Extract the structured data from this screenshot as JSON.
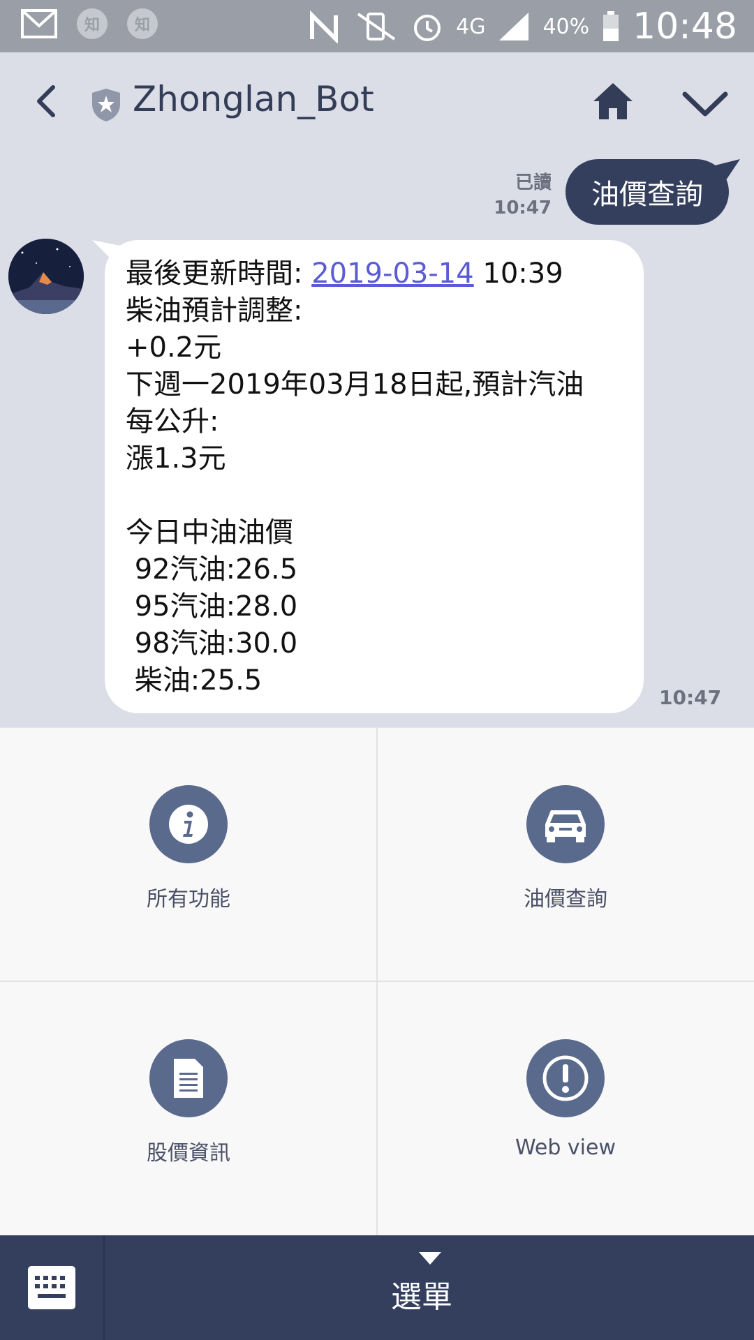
{
  "status_bar": {
    "icons_left": [
      "gmail-icon",
      "zhihu-icon",
      "zhihu-icon"
    ],
    "zhihu_label": "知",
    "network": "4G",
    "battery": "40%",
    "time": "10:48"
  },
  "header": {
    "title": "Zhonglan_Bot"
  },
  "chat": {
    "outgoing": {
      "text": "油價查詢",
      "read_label": "已讀",
      "time": "10:47"
    },
    "incoming": {
      "line1_prefix": "最後更新時間: ",
      "line1_link": "2019-03-14",
      "line1_suffix": " 10:39",
      "lines": [
        "柴油預計調整:",
        "+0.2元",
        "下週一2019年03月18日起,預計汽油",
        "每公升:",
        "漲1.3元",
        "",
        "今日中油油價",
        " 92汽油:26.5",
        " 95汽油:28.0",
        " 98汽油:30.0",
        " 柴油:25.5"
      ],
      "time": "10:47"
    }
  },
  "menu": {
    "items": [
      {
        "label": "所有功能",
        "icon": "info-icon"
      },
      {
        "label": "油價查詢",
        "icon": "car-icon"
      },
      {
        "label": "股價資訊",
        "icon": "document-icon"
      },
      {
        "label": "Web view",
        "icon": "exclamation-icon"
      }
    ]
  },
  "bottom_bar": {
    "menu_label": "選單"
  },
  "colors": {
    "background": "#dbdee7",
    "accent_dark": "#343f5e",
    "icon_circle": "#5a6a8c",
    "link": "#5b5bd6"
  }
}
